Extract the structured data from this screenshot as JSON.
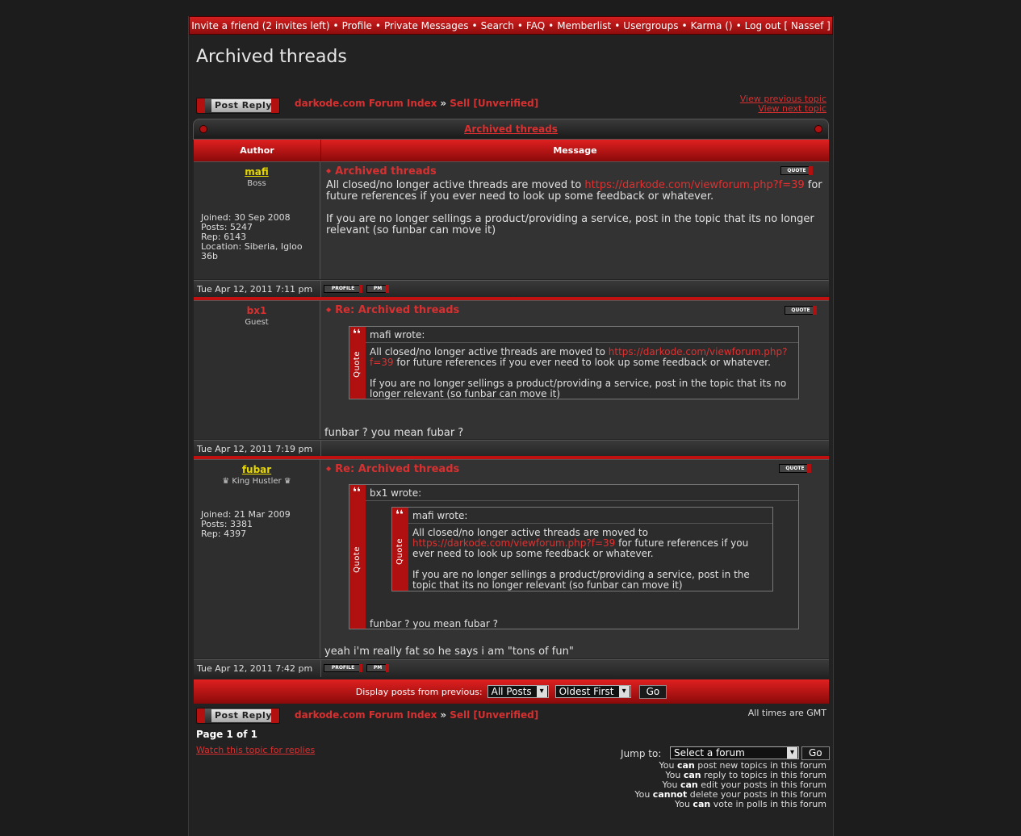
{
  "nav": {
    "items": [
      "Invite a friend (2 invites left)",
      "Profile",
      "Private Messages",
      "Search",
      "FAQ",
      "Memberlist",
      "Usergroups",
      "Karma ()",
      "Log out [ Nassef ]"
    ]
  },
  "page_title": "Archived threads",
  "post_reply_label": "Post Reply",
  "breadcrumb": {
    "index": "darkode.com Forum Index",
    "sep": "»",
    "forum": "Sell [Unverified]"
  },
  "topic_nav": {
    "prev": "View previous topic",
    "next": "View next topic"
  },
  "topic_title": "Archived threads",
  "columns": {
    "author": "Author",
    "message": "Message"
  },
  "buttons": {
    "quote": "QUOTE",
    "profile": "PROFILE",
    "pm": "PM"
  },
  "posts": [
    {
      "author": "mafi",
      "rank": "Boss",
      "info": [
        "Joined: 30 Sep 2008",
        "Posts: 5247",
        "Rep: 6143",
        "Location: Siberia, Igloo 36b"
      ],
      "title": "Archived threads",
      "text_before": "All closed/no longer active threads are moved to ",
      "link": "https://darkode.com/viewforum.php?f=39",
      "text_after": " for future references if you ever need to look up some feedback or whatever.",
      "text2": "If you are no longer sellings a product/providing a service, post in the topic that its no longer relevant (so funbar can move it)",
      "time": "Tue Apr 12, 2011 7:11 pm"
    },
    {
      "author": "bx1",
      "rank": "Guest",
      "title": "Re: Archived threads",
      "quote_author": "mafi wrote:",
      "quote_before": "All closed/no longer active threads are moved to ",
      "quote_link": "https://darkode.com/viewforum.php?f=39",
      "quote_after": " for future references if you ever need to look up some feedback or whatever.",
      "quote_text2": "If you are no longer sellings a product/providing a service, post in the topic that its no longer relevant (so funbar can move it)",
      "reply": "funbar ? you mean fubar ?",
      "time": "Tue Apr 12, 2011 7:19 pm"
    },
    {
      "author": "fubar",
      "rank": "♛ King Hustler ♛",
      "info": [
        "Joined: 21 Mar 2009",
        "Posts: 3381",
        "Rep: 4397"
      ],
      "title": "Re: Archived threads",
      "outer_quote_author": "bx1 wrote:",
      "inner_quote_author": "mafi wrote:",
      "inner_before": "All closed/no longer active threads are moved to ",
      "inner_link": "https://darkode.com/viewforum.php?f=39",
      "inner_after": " for future references if you ever need to look up some feedback or whatever.",
      "inner_text2": "If you are no longer sellings a product/providing a service, post in the topic that its no longer relevant (so funbar can move it)",
      "outer_reply": "funbar ? you mean fubar ?",
      "reply": "yeah i'm really fat so he says i am \"tons of fun\"",
      "time": "Tue Apr 12, 2011 7:42 pm"
    }
  ],
  "quote_label": "Quote",
  "display": {
    "label": "Display posts from previous:",
    "posts_value": "All Posts",
    "order_value": "Oldest First",
    "go": "Go"
  },
  "timezone": "All times are GMT",
  "pagination": "Page 1 of 1",
  "watch": "Watch this topic for replies",
  "jump": {
    "label": "Jump to:",
    "value": "Select a forum",
    "go": "Go"
  },
  "permissions": [
    {
      "pre": "You ",
      "bold": "can",
      "post": " post new topics in this forum"
    },
    {
      "pre": "You ",
      "bold": "can",
      "post": " reply to topics in this forum"
    },
    {
      "pre": "You ",
      "bold": "can",
      "post": " edit your posts in this forum"
    },
    {
      "pre": "You ",
      "bold": "cannot",
      "post": " delete your posts in this forum"
    },
    {
      "pre": "You ",
      "bold": "can",
      "post": " vote in polls in this forum"
    }
  ],
  "colors": {
    "accent": "#d83030",
    "username_highlight": "#e8d800",
    "background": "#222222"
  }
}
